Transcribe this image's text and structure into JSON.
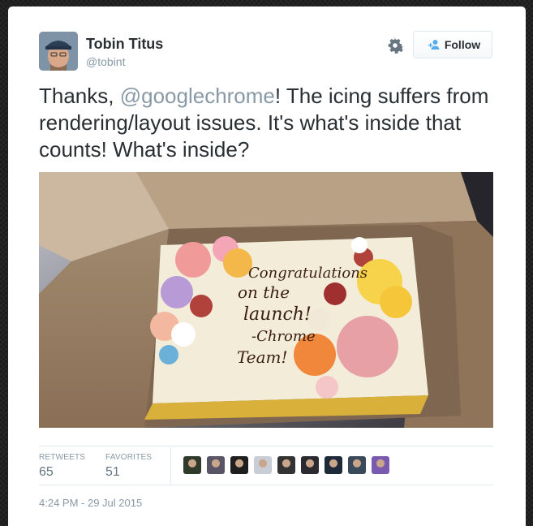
{
  "tweet": {
    "author_name": "Tobin Titus",
    "author_handle": "@tobint",
    "follow_label": "Follow",
    "text_before": "Thanks, ",
    "mention": "@googlechrome",
    "text_after": "! The icing suffers from rendering/layout issues. It's what's inside that counts! What's inside?",
    "photo": {
      "cake_lines": [
        "Congratulations",
        "on the",
        "launch!",
        "-Chrome",
        "Team!"
      ]
    },
    "stats": {
      "retweets_label": "RETWEETS",
      "retweets_value": "65",
      "favorites_label": "FAVORITES",
      "favorites_value": "51"
    },
    "favoriters": [
      {
        "color": "#2f3a2a"
      },
      {
        "color": "#5a5566"
      },
      {
        "color": "#1f1f1f"
      },
      {
        "color": "#c9ced6"
      },
      {
        "color": "#333333"
      },
      {
        "color": "#2a2a30"
      },
      {
        "color": "#1e2a3a"
      },
      {
        "color": "#3a4a5a"
      },
      {
        "color": "#7a5ab0"
      }
    ],
    "timestamp": "4:24 PM - 29 Jul 2015"
  },
  "colors": {
    "text": "#292f33",
    "muted": "#8899a6",
    "accent": "#55acee"
  },
  "icons": [
    "gear-icon",
    "follow-person-icon"
  ]
}
